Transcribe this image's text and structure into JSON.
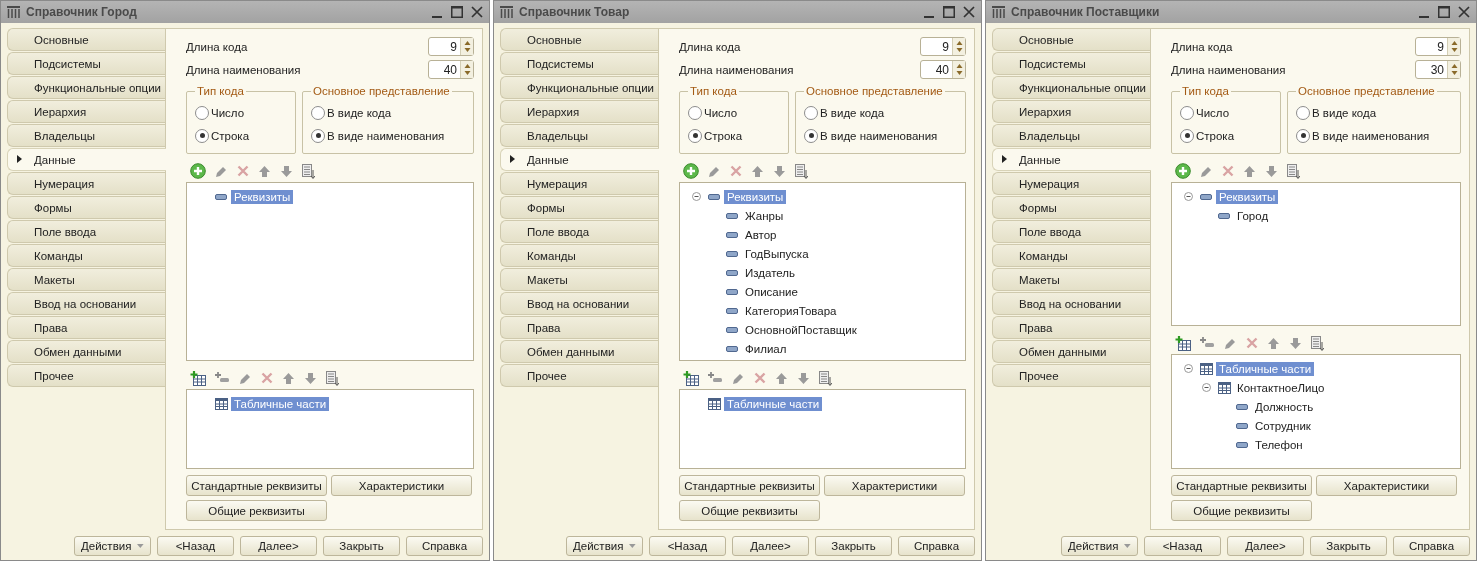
{
  "windows": [
    {
      "title": "Справочник Город",
      "tabs": [
        {
          "label": "Основные",
          "selected": false
        },
        {
          "label": "Подсистемы",
          "selected": false
        },
        {
          "label": "Функциональные опции",
          "selected": false
        },
        {
          "label": "Иерархия",
          "selected": false
        },
        {
          "label": "Владельцы",
          "selected": false
        },
        {
          "label": "Данные",
          "selected": true
        },
        {
          "label": "Нумерация",
          "selected": false
        },
        {
          "label": "Формы",
          "selected": false
        },
        {
          "label": "Поле ввода",
          "selected": false
        },
        {
          "label": "Команды",
          "selected": false
        },
        {
          "label": "Макеты",
          "selected": false
        },
        {
          "label": "Ввод на основании",
          "selected": false
        },
        {
          "label": "Права",
          "selected": false
        },
        {
          "label": "Обмен данными",
          "selected": false
        },
        {
          "label": "Прочее",
          "selected": false
        }
      ],
      "fields": [
        {
          "label": "Длина кода",
          "value": "9"
        },
        {
          "label": "Длина наименования",
          "value": "40"
        }
      ],
      "groups": [
        {
          "title": "Тип кода",
          "options": [
            {
              "label": "Число",
              "selected": false
            },
            {
              "label": "Строка",
              "selected": true
            }
          ]
        },
        {
          "title": "Основное представление",
          "options": [
            {
              "label": "В виде кода",
              "selected": false
            },
            {
              "label": "В виде наименования",
              "selected": true
            }
          ]
        }
      ],
      "attributes": [
        {
          "label": "Реквизиты",
          "kind": "attribute",
          "selected": true
        }
      ],
      "tabular_parts": [
        {
          "label": "Табличные части",
          "kind": "table",
          "selected": true
        }
      ],
      "buttons": [
        "Стандартные реквизиты",
        "Характеристики",
        "Общие реквизиты"
      ],
      "footer": [
        "Действия",
        "<Назад",
        "Далее>",
        "Закрыть",
        "Справка"
      ]
    },
    {
      "title": "Справочник Товар",
      "tabs": [
        {
          "label": "Основные",
          "selected": false
        },
        {
          "label": "Подсистемы",
          "selected": false
        },
        {
          "label": "Функциональные опции",
          "selected": false
        },
        {
          "label": "Иерархия",
          "selected": false
        },
        {
          "label": "Владельцы",
          "selected": false
        },
        {
          "label": "Данные",
          "selected": true
        },
        {
          "label": "Нумерация",
          "selected": false
        },
        {
          "label": "Формы",
          "selected": false
        },
        {
          "label": "Поле ввода",
          "selected": false
        },
        {
          "label": "Команды",
          "selected": false
        },
        {
          "label": "Макеты",
          "selected": false
        },
        {
          "label": "Ввод на основании",
          "selected": false
        },
        {
          "label": "Права",
          "selected": false
        },
        {
          "label": "Обмен данными",
          "selected": false
        },
        {
          "label": "Прочее",
          "selected": false
        }
      ],
      "fields": [
        {
          "label": "Длина кода",
          "value": "9"
        },
        {
          "label": "Длина наименования",
          "value": "40"
        }
      ],
      "groups": [
        {
          "title": "Тип кода",
          "options": [
            {
              "label": "Число",
              "selected": false
            },
            {
              "label": "Строка",
              "selected": true
            }
          ]
        },
        {
          "title": "Основное представление",
          "options": [
            {
              "label": "В виде кода",
              "selected": false
            },
            {
              "label": "В виде наименования",
              "selected": true
            }
          ]
        }
      ],
      "attributes": [
        {
          "label": "Реквизиты",
          "kind": "attribute",
          "selected": true,
          "expanded": true,
          "children": [
            {
              "label": "Жанры",
              "kind": "attribute",
              "selected": false
            },
            {
              "label": "Автор",
              "kind": "attribute",
              "selected": false
            },
            {
              "label": "ГодВыпуска",
              "kind": "attribute",
              "selected": false
            },
            {
              "label": "Издатель",
              "kind": "attribute",
              "selected": false
            },
            {
              "label": "Описание",
              "kind": "attribute",
              "selected": false
            },
            {
              "label": "КатегорияТовара",
              "kind": "attribute",
              "selected": false
            },
            {
              "label": "ОсновнойПоставщик",
              "kind": "attribute",
              "selected": false
            },
            {
              "label": "Филиал",
              "kind": "attribute",
              "selected": false
            }
          ]
        }
      ],
      "tabular_parts": [
        {
          "label": "Табличные части",
          "kind": "table",
          "selected": true
        }
      ],
      "buttons": [
        "Стандартные реквизиты",
        "Характеристики",
        "Общие реквизиты"
      ],
      "footer": [
        "Действия",
        "<Назад",
        "Далее>",
        "Закрыть",
        "Справка"
      ]
    },
    {
      "title": "Справочник Поставщики",
      "tabs": [
        {
          "label": "Основные",
          "selected": false
        },
        {
          "label": "Подсистемы",
          "selected": false
        },
        {
          "label": "Функциональные опции",
          "selected": false
        },
        {
          "label": "Иерархия",
          "selected": false
        },
        {
          "label": "Владельцы",
          "selected": false
        },
        {
          "label": "Данные",
          "selected": true
        },
        {
          "label": "Нумерация",
          "selected": false
        },
        {
          "label": "Формы",
          "selected": false
        },
        {
          "label": "Поле ввода",
          "selected": false
        },
        {
          "label": "Команды",
          "selected": false
        },
        {
          "label": "Макеты",
          "selected": false
        },
        {
          "label": "Ввод на основании",
          "selected": false
        },
        {
          "label": "Права",
          "selected": false
        },
        {
          "label": "Обмен данными",
          "selected": false
        },
        {
          "label": "Прочее",
          "selected": false
        }
      ],
      "fields": [
        {
          "label": "Длина кода",
          "value": "9"
        },
        {
          "label": "Длина наименования",
          "value": "30"
        }
      ],
      "groups": [
        {
          "title": "Тип кода",
          "options": [
            {
              "label": "Число",
              "selected": false
            },
            {
              "label": "Строка",
              "selected": true
            }
          ]
        },
        {
          "title": "Основное представление",
          "options": [
            {
              "label": "В виде кода",
              "selected": false
            },
            {
              "label": "В виде наименования",
              "selected": true
            }
          ]
        }
      ],
      "attributes": [
        {
          "label": "Реквизиты",
          "kind": "attribute",
          "selected": true,
          "expanded": true,
          "children": [
            {
              "label": "Город",
              "kind": "attribute",
              "selected": false
            }
          ]
        }
      ],
      "tabular_parts": [
        {
          "label": "Табличные части",
          "kind": "table",
          "selected": true,
          "expanded": true,
          "children": [
            {
              "label": "КонтактноеЛицо",
              "kind": "table",
              "selected": false,
              "expanded": true,
              "children": [
                {
                  "label": "Должность",
                  "kind": "attribute",
                  "selected": false
                },
                {
                  "label": "Сотрудник",
                  "kind": "attribute",
                  "selected": false
                },
                {
                  "label": "Телефон",
                  "kind": "attribute",
                  "selected": false
                }
              ]
            }
          ]
        }
      ],
      "buttons": [
        "Стандартные реквизиты",
        "Характеристики",
        "Общие реквизиты"
      ],
      "footer": [
        "Действия",
        "<Назад",
        "Далее>",
        "Закрыть",
        "Справка"
      ]
    }
  ]
}
